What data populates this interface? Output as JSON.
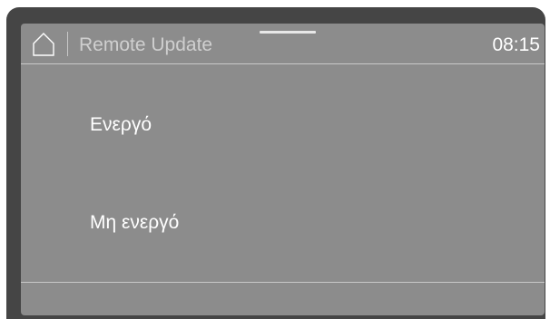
{
  "header": {
    "home_icon": "home-icon",
    "title": "Remote Update",
    "time": "08:15"
  },
  "options": [
    {
      "label": "Ενεργό"
    },
    {
      "label": "Μη ενεργό"
    }
  ],
  "colors": {
    "bezel": "#454545",
    "screen": "#8c8c8c",
    "title_text": "#cfcfcf",
    "text": "#ffffff"
  }
}
